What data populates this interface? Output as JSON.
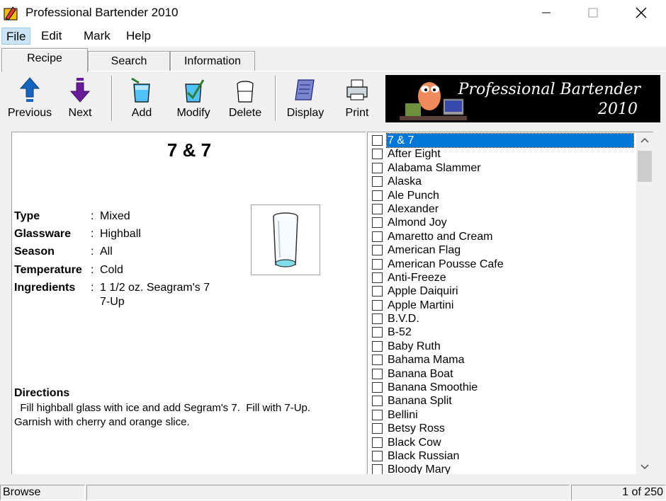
{
  "window": {
    "title": "Professional Bartender 2010"
  },
  "menu": {
    "file": "File",
    "edit": "Edit",
    "mark": "Mark",
    "help": "Help"
  },
  "tabs": {
    "recipe": "Recipe",
    "search": "Search",
    "information": "Information"
  },
  "toolbar": {
    "previous": "Previous",
    "next": "Next",
    "add": "Add",
    "modify": "Modify",
    "delete": "Delete",
    "display": "Display",
    "print": "Print"
  },
  "logo": {
    "line1": "Professional Bartender",
    "line2": "2010"
  },
  "recipe": {
    "name": "7 & 7",
    "labels": {
      "type": "Type",
      "glassware": "Glassware",
      "season": "Season",
      "temperature": "Temperature",
      "ingredients": "Ingredients",
      "directions": "Directions"
    },
    "colon": ":",
    "type": "Mixed",
    "glassware": "Highball",
    "season": "All",
    "temperature": "Cold",
    "ingredients": [
      "1 1/2 oz. Seagram's 7",
      "7-Up"
    ],
    "directions_line1": "  Fill highball glass with ice and add Segram's 7.  Fill with 7-Up.",
    "directions_line2": "Garnish with cherry and orange slice."
  },
  "list": {
    "items": [
      "7 & 7",
      "After Eight",
      "Alabama Slammer",
      "Alaska",
      "Ale Punch",
      "Alexander",
      "Almond Joy",
      "Amaretto and Cream",
      "American Flag",
      "American Pousse Cafe",
      "Anti-Freeze",
      "Apple Daiquiri",
      "Apple Martini",
      "B.V.D.",
      "B-52",
      "Baby Ruth",
      "Bahama Mama",
      "Banana Boat",
      "Banana Smoothie",
      "Banana Split",
      "Bellini",
      "Betsy Ross",
      "Black Cow",
      "Black Russian",
      "Bloody Mary"
    ],
    "selected_index": 0
  },
  "status": {
    "mode": "Browse",
    "count": "1 of 250"
  },
  "colors": {
    "selection": "#0078d7",
    "panel": "#f0f0f0",
    "arrow_blue": "#1565c0",
    "arrow_purple": "#6a1b9a"
  }
}
